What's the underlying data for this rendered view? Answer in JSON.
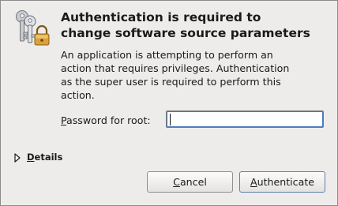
{
  "dialog": {
    "icon": "keys-and-lock-icon",
    "title_lines": [
      "Authentication is required to",
      "change software source parameters"
    ],
    "message_lines": [
      "An application is attempting to perform an",
      "action that requires privileges. Authentication",
      "as the super user is required to perform this",
      "action."
    ],
    "password": {
      "label_mnemonic": "P",
      "label_rest": "assword for root:",
      "value": ""
    },
    "details": {
      "icon": "expander-arrow-icon",
      "label_mnemonic": "D",
      "label_rest": "etails"
    },
    "buttons": {
      "cancel_mnemonic": "C",
      "cancel_rest": "ancel",
      "auth_mnemonic": "A",
      "auth_rest": "uthenticate"
    }
  }
}
